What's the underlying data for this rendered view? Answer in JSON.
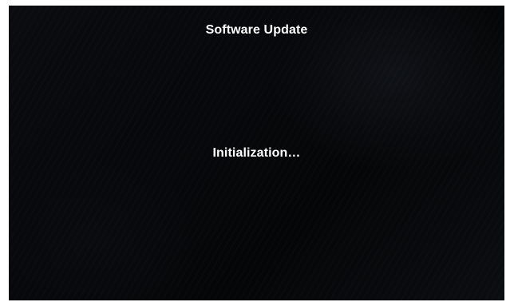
{
  "screen": {
    "title": "Software Update",
    "status": "Initialization…"
  },
  "colors": {
    "background": "#07080b",
    "text": "#ffffff",
    "frame": "#ffffff"
  }
}
